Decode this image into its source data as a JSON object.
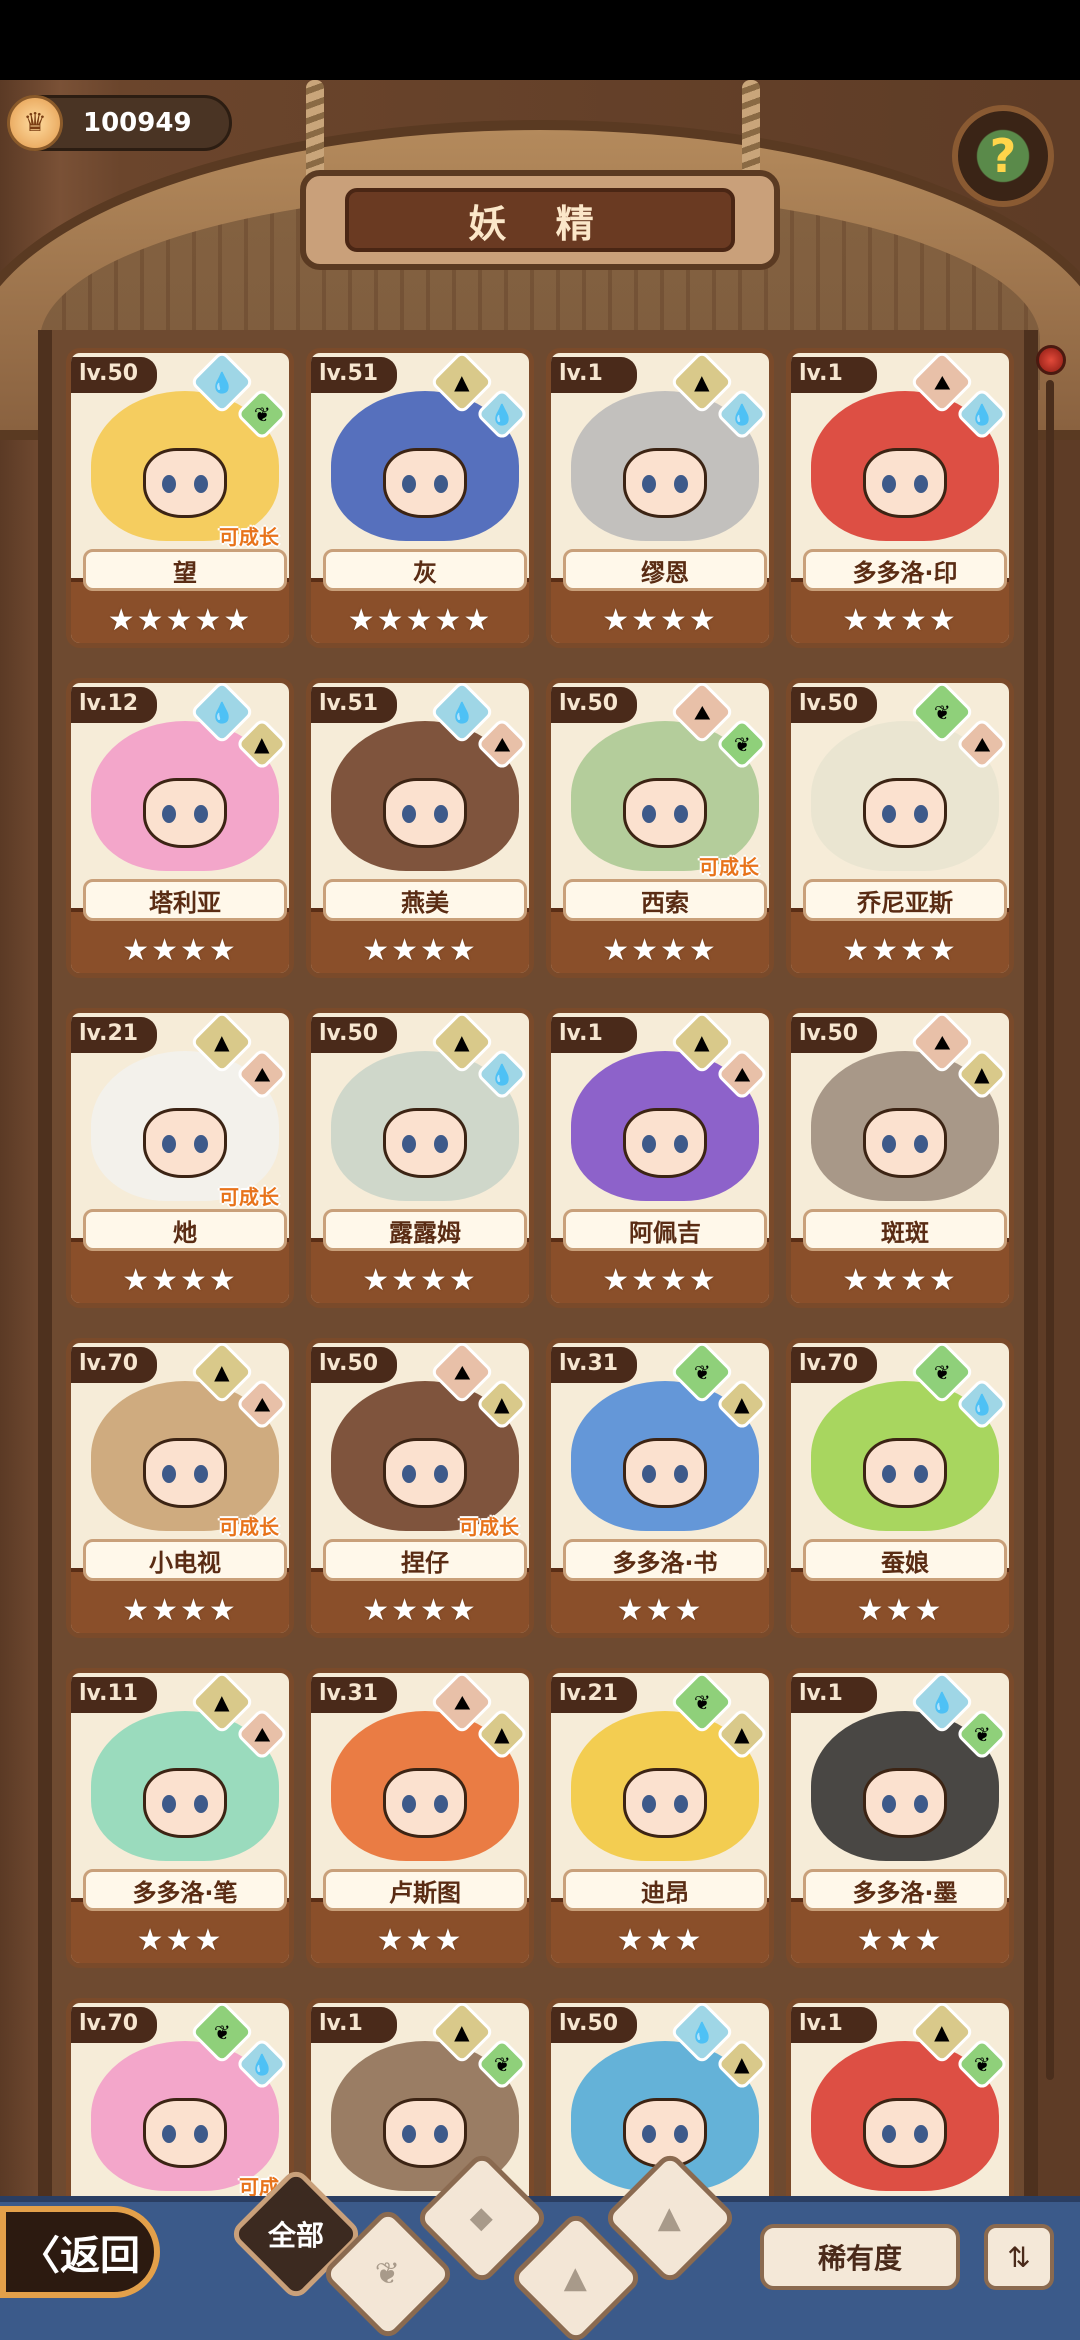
{
  "currency": {
    "value": "100949",
    "icon": "crown-coin-icon"
  },
  "header": {
    "title": "妖 精",
    "help_icon": "question-sprout-icon"
  },
  "colors": {
    "water": "#9fd6e6",
    "earth": "#d9c98a",
    "plant": "#8fd07a",
    "mountain": "#e8c0a8"
  },
  "cards": [
    {
      "level": "lv.50",
      "name": "望",
      "stars": "★★★★★",
      "grow": "可成长",
      "elements": [
        "water",
        "plant"
      ],
      "tint": "#f4c84a"
    },
    {
      "level": "lv.51",
      "name": "灰",
      "stars": "★★★★★",
      "grow": "",
      "elements": [
        "earth",
        "water"
      ],
      "tint": "#3a5ab8"
    },
    {
      "level": "lv.1",
      "name": "缪恩",
      "stars": "★★★★",
      "grow": "",
      "elements": [
        "earth",
        "water"
      ],
      "tint": "#b8b8b8"
    },
    {
      "level": "lv.1",
      "name": "多多洛·印",
      "stars": "★★★★",
      "grow": "",
      "elements": [
        "mountain",
        "water"
      ],
      "tint": "#d8342a"
    },
    {
      "level": "lv.12",
      "name": "塔利亚",
      "stars": "★★★★",
      "grow": "",
      "elements": [
        "water",
        "earth"
      ],
      "tint": "#f29ac8"
    },
    {
      "level": "lv.51",
      "name": "燕美",
      "stars": "★★★★",
      "grow": "",
      "elements": [
        "water",
        "mountain"
      ],
      "tint": "#6a3a22"
    },
    {
      "level": "lv.50",
      "name": "西索",
      "stars": "★★★★",
      "grow": "可成长",
      "elements": [
        "mountain",
        "plant"
      ],
      "tint": "#a8c890"
    },
    {
      "level": "lv.50",
      "name": "乔尼亚斯",
      "stars": "★★★★",
      "grow": "",
      "elements": [
        "plant",
        "mountain"
      ],
      "tint": "#e8e4d0"
    },
    {
      "level": "lv.21",
      "name": "灺",
      "stars": "★★★★",
      "grow": "可成长",
      "elements": [
        "earth",
        "mountain"
      ],
      "tint": "#f2f2ee"
    },
    {
      "level": "lv.50",
      "name": "露露姆",
      "stars": "★★★★",
      "grow": "",
      "elements": [
        "earth",
        "water"
      ],
      "tint": "#c8d4c8"
    },
    {
      "level": "lv.1",
      "name": "阿佩吉",
      "stars": "★★★★",
      "grow": "",
      "elements": [
        "earth",
        "mountain"
      ],
      "tint": "#7a4ac8"
    },
    {
      "level": "lv.50",
      "name": "斑斑",
      "stars": "★★★★",
      "grow": "",
      "elements": [
        "mountain",
        "earth"
      ],
      "tint": "#9a8a7a"
    },
    {
      "level": "lv.70",
      "name": "小电视",
      "stars": "★★★★",
      "grow": "可成长",
      "elements": [
        "earth",
        "mountain"
      ],
      "tint": "#c8a070"
    },
    {
      "level": "lv.50",
      "name": "捏仔",
      "stars": "★★★★",
      "grow": "可成长",
      "elements": [
        "mountain",
        "earth"
      ],
      "tint": "#6a3a22"
    },
    {
      "level": "lv.31",
      "name": "多多洛·书",
      "stars": "★★★",
      "grow": "",
      "elements": [
        "plant",
        "earth"
      ],
      "tint": "#4a88d8"
    },
    {
      "level": "lv.70",
      "name": "蚕娘",
      "stars": "★★★",
      "grow": "",
      "elements": [
        "plant",
        "water"
      ],
      "tint": "#9ad24a"
    },
    {
      "level": "lv.11",
      "name": "多多洛·笔",
      "stars": "★★★",
      "grow": "",
      "elements": [
        "earth",
        "mountain"
      ],
      "tint": "#8ad8b8"
    },
    {
      "level": "lv.31",
      "name": "卢斯图",
      "stars": "★★★",
      "grow": "",
      "elements": [
        "mountain",
        "earth"
      ],
      "tint": "#e8682a"
    },
    {
      "level": "lv.21",
      "name": "迪昂",
      "stars": "★★★",
      "grow": "",
      "elements": [
        "plant",
        "earth"
      ],
      "tint": "#f2c83a"
    },
    {
      "level": "lv.1",
      "name": "多多洛·墨",
      "stars": "★★★",
      "grow": "",
      "elements": [
        "water",
        "plant"
      ],
      "tint": "#2a2a2a"
    },
    {
      "level": "lv.70",
      "name": "",
      "stars": "",
      "grow": "可成",
      "elements": [
        "plant",
        "water"
      ],
      "tint": "#f29ac8"
    },
    {
      "level": "lv.1",
      "name": "",
      "stars": "",
      "grow": "",
      "elements": [
        "earth",
        "plant"
      ],
      "tint": "#8a6a50"
    },
    {
      "level": "lv.50",
      "name": "",
      "stars": "",
      "grow": "",
      "elements": [
        "water",
        "earth"
      ],
      "tint": "#4aa8d8"
    },
    {
      "level": "lv.1",
      "name": "",
      "stars": "",
      "grow": "",
      "elements": [
        "earth",
        "plant"
      ],
      "tint": "#d8342a"
    }
  ],
  "bottom": {
    "back_label": "〈返回",
    "filter_all": "全部",
    "filters": [
      "plant-filter-icon",
      "water-filter-icon",
      "mountain-filter-icon",
      "earth-filter-icon"
    ],
    "sort_label": "稀有度",
    "order_icon": "sort-order-icon"
  }
}
